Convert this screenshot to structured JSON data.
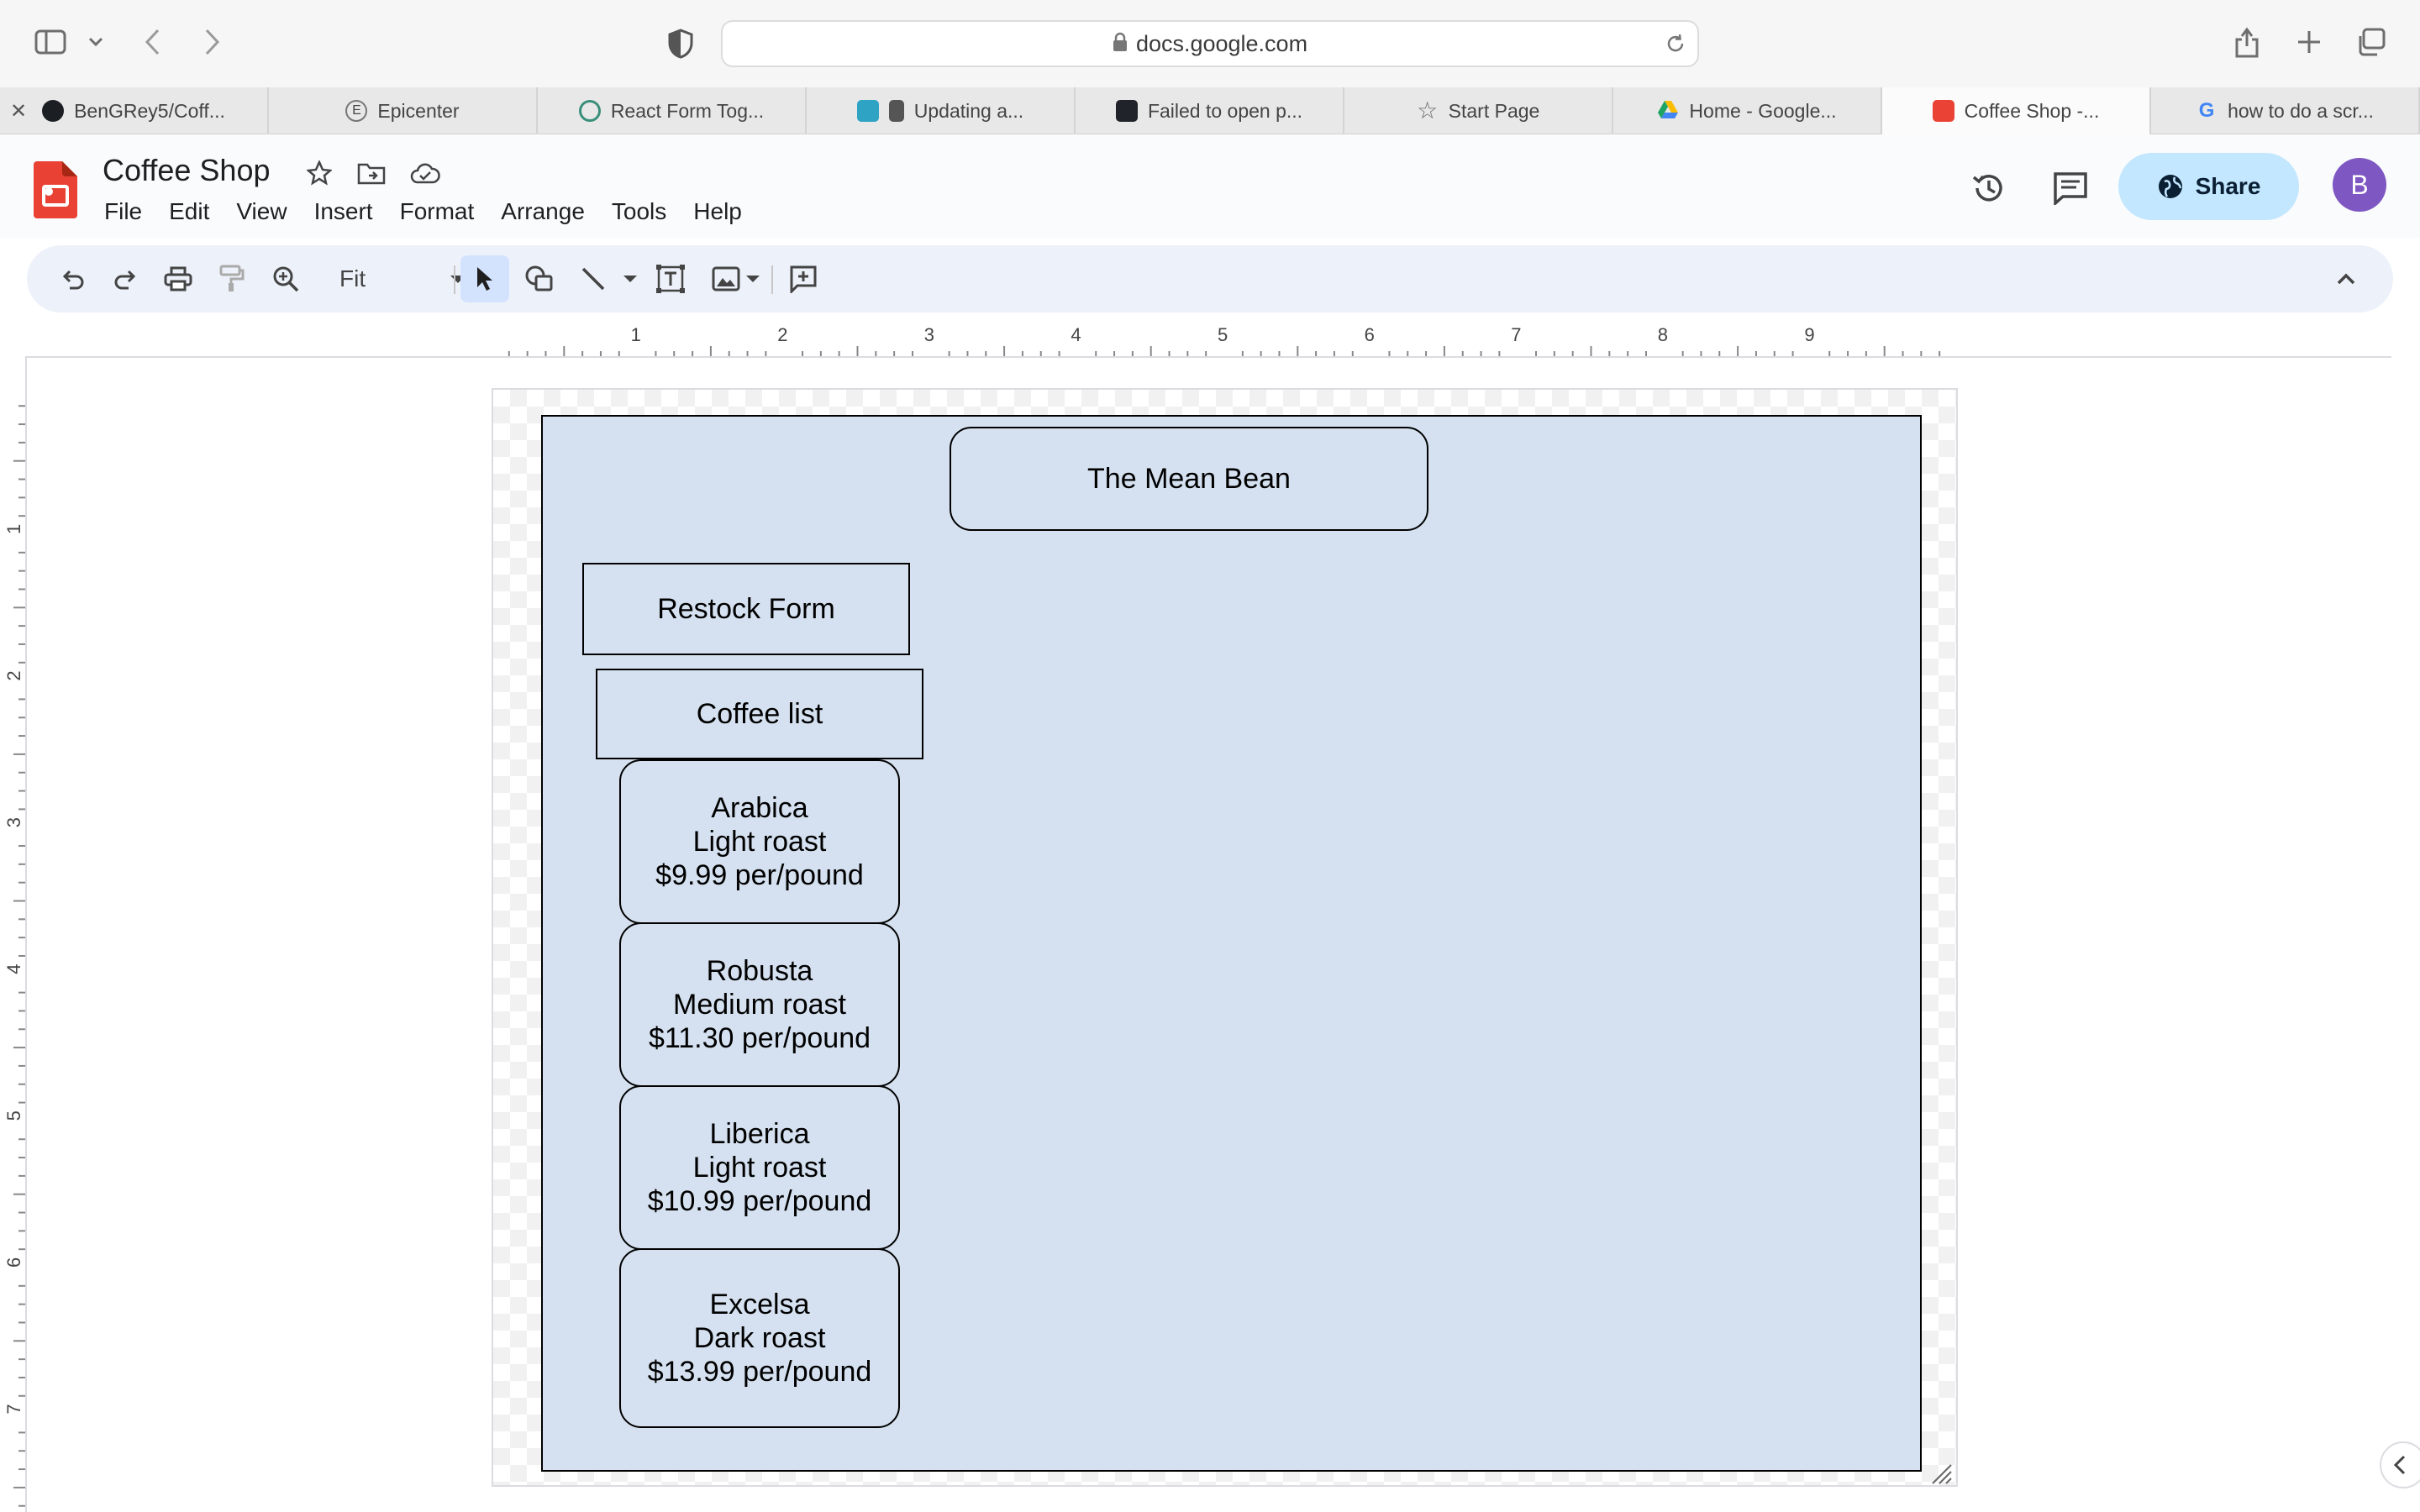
{
  "browser": {
    "address": "docs.google.com",
    "tabs": [
      {
        "label": "BenGRey5/Coff...",
        "fav_color": "#1b1f23",
        "has_close": true
      },
      {
        "label": "Epicenter",
        "fav_color": "#ffffff"
      },
      {
        "label": "React Form Tog...",
        "fav_color": "#3a8f7a"
      },
      {
        "label": "Updating a...",
        "fav_color": "#2fa3c4"
      },
      {
        "label": "Failed to open p...",
        "fav_color": "#20232a"
      },
      {
        "label": "Start Page",
        "fav_color": "#ffffff"
      },
      {
        "label": "Home - Google...",
        "fav_color": "#1fa463"
      },
      {
        "label": "Coffee Shop -...",
        "fav_color": "#ea4335",
        "active": true
      },
      {
        "label": "how to do a scr...",
        "fav_color": "#4285f4"
      }
    ]
  },
  "app": {
    "doc_title": "Coffee Shop",
    "menu": [
      "File",
      "Edit",
      "View",
      "Insert",
      "Format",
      "Arrange",
      "Tools",
      "Help"
    ],
    "share_label": "Share",
    "avatar_letter": "B",
    "zoom": "Fit"
  },
  "ruler": {
    "h_marks": [
      "1",
      "2",
      "3",
      "4",
      "5",
      "6",
      "7",
      "8",
      "9"
    ],
    "v_marks": [
      "1",
      "2",
      "3",
      "4",
      "5",
      "6",
      "7"
    ]
  },
  "slide": {
    "title": "The Mean Bean",
    "restock": "Restock Form",
    "coffee_list": "Coffee list",
    "coffees": [
      {
        "name": "Arabica",
        "roast": "Light roast",
        "price": "$9.99 per/pound"
      },
      {
        "name": "Robusta",
        "roast": "Medium roast",
        "price": "$11.30 per/pound"
      },
      {
        "name": "Liberica",
        "roast": "Light roast",
        "price": "$10.99 per/pound"
      },
      {
        "name": "Excelsa",
        "roast": "Dark roast",
        "price": "$13.99 per/pound"
      }
    ],
    "colors": {
      "slide_fill": "#d5e1f0",
      "border": "#000000"
    }
  },
  "icons": [
    "sidebar-icon",
    "chevron-down-icon",
    "back-icon",
    "forward-icon",
    "shield-icon",
    "lock-icon",
    "reload-icon",
    "share-out-icon",
    "new-tab-icon",
    "tab-overview-icon",
    "star-icon",
    "move-folder-icon",
    "cloud-icon",
    "history-icon",
    "comment-icon",
    "globe-icon",
    "undo-icon",
    "redo-icon",
    "print-icon",
    "paint-format-icon",
    "zoom-icon",
    "select-icon",
    "shape-icon",
    "line-icon",
    "textbox-icon",
    "image-icon",
    "add-comment-icon",
    "collapse-icon"
  ]
}
